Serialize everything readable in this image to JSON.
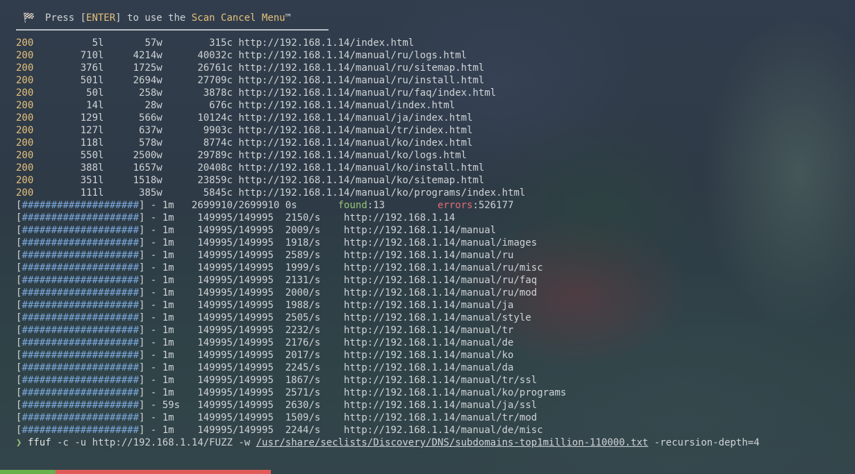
{
  "banner": {
    "flag_icon": "🏁",
    "pre": "Press [",
    "key": "ENTER",
    "mid": "] to use the ",
    "menu": "Scan Cancel Menu",
    "tm": "™"
  },
  "results": [
    {
      "status": "200",
      "lines": "5l",
      "words": "57w",
      "chars": "315c",
      "url": "http://192.168.1.14/index.html"
    },
    {
      "status": "200",
      "lines": "710l",
      "words": "4214w",
      "chars": "40032c",
      "url": "http://192.168.1.14/manual/ru/logs.html"
    },
    {
      "status": "200",
      "lines": "376l",
      "words": "1725w",
      "chars": "26761c",
      "url": "http://192.168.1.14/manual/ru/sitemap.html"
    },
    {
      "status": "200",
      "lines": "501l",
      "words": "2694w",
      "chars": "27709c",
      "url": "http://192.168.1.14/manual/ru/install.html"
    },
    {
      "status": "200",
      "lines": "50l",
      "words": "258w",
      "chars": "3878c",
      "url": "http://192.168.1.14/manual/ru/faq/index.html"
    },
    {
      "status": "200",
      "lines": "14l",
      "words": "28w",
      "chars": "676c",
      "url": "http://192.168.1.14/manual/index.html"
    },
    {
      "status": "200",
      "lines": "129l",
      "words": "566w",
      "chars": "10124c",
      "url": "http://192.168.1.14/manual/ja/index.html"
    },
    {
      "status": "200",
      "lines": "127l",
      "words": "637w",
      "chars": "9903c",
      "url": "http://192.168.1.14/manual/tr/index.html"
    },
    {
      "status": "200",
      "lines": "118l",
      "words": "578w",
      "chars": "8774c",
      "url": "http://192.168.1.14/manual/ko/index.html"
    },
    {
      "status": "200",
      "lines": "550l",
      "words": "2500w",
      "chars": "29789c",
      "url": "http://192.168.1.14/manual/ko/logs.html"
    },
    {
      "status": "200",
      "lines": "388l",
      "words": "1657w",
      "chars": "20408c",
      "url": "http://192.168.1.14/manual/ko/install.html"
    },
    {
      "status": "200",
      "lines": "351l",
      "words": "1518w",
      "chars": "23859c",
      "url": "http://192.168.1.14/manual/ko/sitemap.html"
    },
    {
      "status": "200",
      "lines": "111l",
      "words": "385w",
      "chars": "5845c",
      "url": "http://192.168.1.14/manual/ko/programs/index.html"
    }
  ],
  "summary": {
    "bar": "####################",
    "time": "1m",
    "count": "2699910/2699910",
    "eta": "0s",
    "found_label": "found",
    "found_value": "13",
    "errors_label": "errors",
    "errors_value": "526177"
  },
  "progress": [
    {
      "time": "1m",
      "count": "149995/149995",
      "rate": "2150/s",
      "url": "http://192.168.1.14"
    },
    {
      "time": "1m",
      "count": "149995/149995",
      "rate": "2009/s",
      "url": "http://192.168.1.14/manual"
    },
    {
      "time": "1m",
      "count": "149995/149995",
      "rate": "1918/s",
      "url": "http://192.168.1.14/manual/images"
    },
    {
      "time": "1m",
      "count": "149995/149995",
      "rate": "2589/s",
      "url": "http://192.168.1.14/manual/ru"
    },
    {
      "time": "1m",
      "count": "149995/149995",
      "rate": "1999/s",
      "url": "http://192.168.1.14/manual/ru/misc"
    },
    {
      "time": "1m",
      "count": "149995/149995",
      "rate": "2131/s",
      "url": "http://192.168.1.14/manual/ru/faq"
    },
    {
      "time": "1m",
      "count": "149995/149995",
      "rate": "2000/s",
      "url": "http://192.168.1.14/manual/ru/mod"
    },
    {
      "time": "1m",
      "count": "149995/149995",
      "rate": "1988/s",
      "url": "http://192.168.1.14/manual/ja"
    },
    {
      "time": "1m",
      "count": "149995/149995",
      "rate": "2505/s",
      "url": "http://192.168.1.14/manual/style"
    },
    {
      "time": "1m",
      "count": "149995/149995",
      "rate": "2232/s",
      "url": "http://192.168.1.14/manual/tr"
    },
    {
      "time": "1m",
      "count": "149995/149995",
      "rate": "2176/s",
      "url": "http://192.168.1.14/manual/de"
    },
    {
      "time": "1m",
      "count": "149995/149995",
      "rate": "2017/s",
      "url": "http://192.168.1.14/manual/ko"
    },
    {
      "time": "1m",
      "count": "149995/149995",
      "rate": "2245/s",
      "url": "http://192.168.1.14/manual/da"
    },
    {
      "time": "1m",
      "count": "149995/149995",
      "rate": "1867/s",
      "url": "http://192.168.1.14/manual/tr/ssl"
    },
    {
      "time": "1m",
      "count": "149995/149995",
      "rate": "2571/s",
      "url": "http://192.168.1.14/manual/ko/programs"
    },
    {
      "time": "59s",
      "count": "149995/149995",
      "rate": "2630/s",
      "url": "http://192.168.1.14/manual/ja/ssl"
    },
    {
      "time": "1m",
      "count": "149995/149995",
      "rate": "1509/s",
      "url": "http://192.168.1.14/manual/tr/mod"
    },
    {
      "time": "1m",
      "count": "149995/149995",
      "rate": "2244/s",
      "url": "http://192.168.1.14/manual/de/misc"
    }
  ],
  "prompt": {
    "symbol": "❯",
    "command": "ffuf",
    "args": "-c -u http://192.168.1.14/FUZZ -w",
    "wordlist": "/usr/share/seclists/Discovery/DNS/subdomains-top1million-110000.txt",
    "extra": "-recursion-depth=4"
  },
  "colors": {
    "accent": "#e5c07b",
    "bar": "#7aa6da",
    "found": "#98c379",
    "errors": "#e06c75"
  }
}
